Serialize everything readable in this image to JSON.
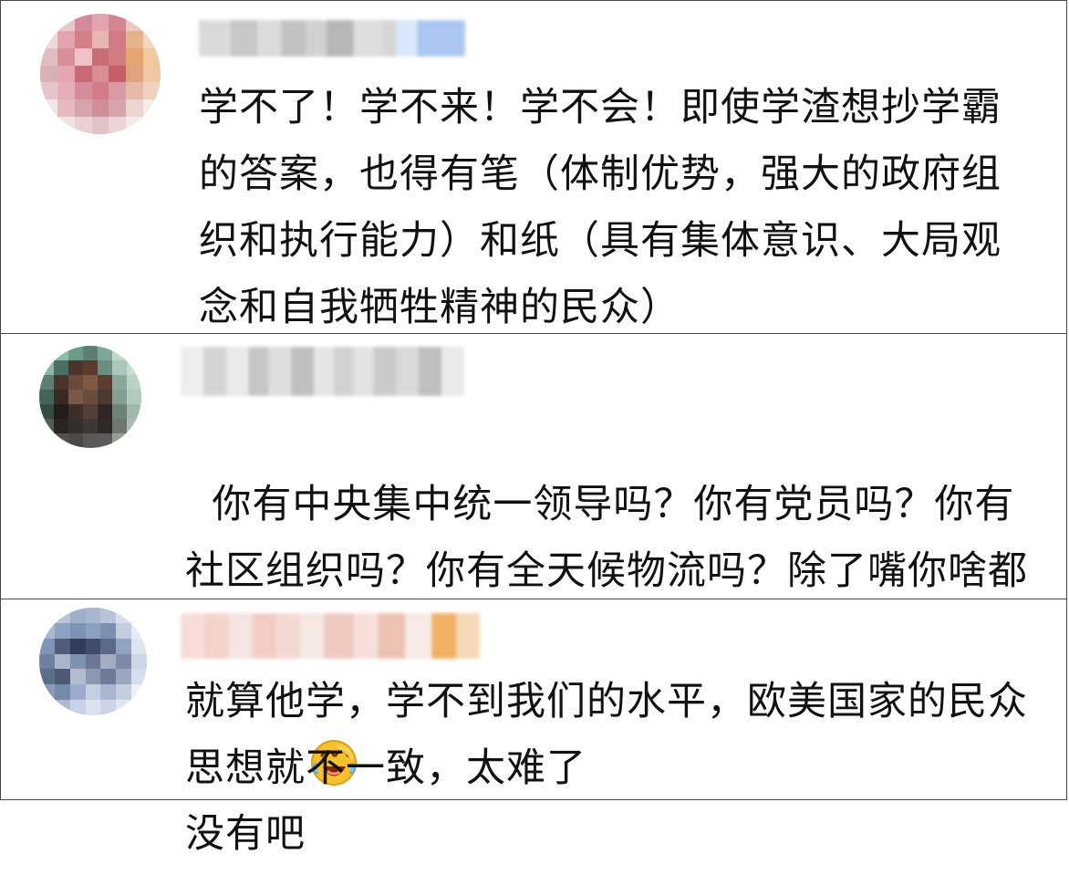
{
  "comments": [
    {
      "avatar": {
        "label": ""
      },
      "username": "",
      "text": "学不了！学不来！学不会！即使学渣想抄学霸的答案，也得有笔（体制优势，强大的政府组织和执行能力）和纸（具有集体意识、大局观念和自我牺牲精神的民众）"
    },
    {
      "avatar": {
        "label": ""
      },
      "username": "",
      "text": "你有中央集中统一领导吗？你有党员吗？你有社区组织吗？你有全天候物流吗？除了嘴你啥都没有吧",
      "emoji": "laughing-crying-face-icon"
    },
    {
      "avatar": {
        "label": ""
      },
      "username": "",
      "text": "就算他学，学不到我们的水平，欧美国家的民众思想就不一致，太难了"
    }
  ]
}
